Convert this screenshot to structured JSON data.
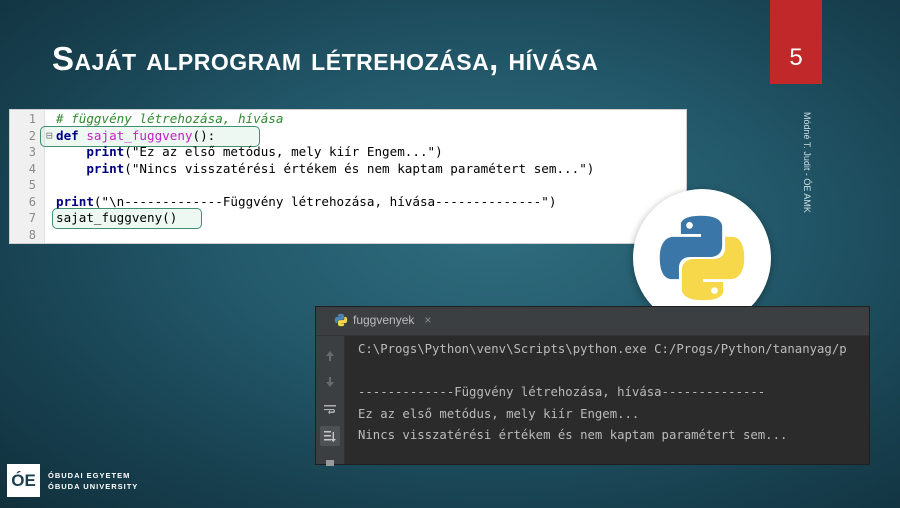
{
  "slide": {
    "title": "Saját alprogram létrehozása, hívása",
    "number": "5",
    "author_vertical": "Módné T. Judit - ÓE AMK",
    "accent_color": "#c0282a"
  },
  "editor": {
    "lines": [
      {
        "num": "1",
        "fold": "",
        "parts": [
          {
            "cls": "c-comment",
            "text": "# függvény létrehozása, hívása"
          }
        ]
      },
      {
        "num": "2",
        "fold": "⊟",
        "parts": [
          {
            "cls": "c-kw",
            "text": "def "
          },
          {
            "cls": "c-fn",
            "text": "sajat_fuggveny"
          },
          {
            "cls": "c-plain",
            "text": "():"
          }
        ]
      },
      {
        "num": "3",
        "fold": "",
        "parts": [
          {
            "cls": "c-plain",
            "text": "    "
          },
          {
            "cls": "c-kw",
            "text": "print"
          },
          {
            "cls": "c-plain",
            "text": "(\"Ez az első metódus, mely kiír Engem...\")"
          }
        ]
      },
      {
        "num": "4",
        "fold": "",
        "parts": [
          {
            "cls": "c-plain",
            "text": "    "
          },
          {
            "cls": "c-kw",
            "text": "print"
          },
          {
            "cls": "c-plain",
            "text": "(\"Nincs visszatérési értékem és nem kaptam paramétert sem...\")"
          }
        ]
      },
      {
        "num": "5",
        "fold": "",
        "parts": []
      },
      {
        "num": "6",
        "fold": "",
        "parts": [
          {
            "cls": "c-kw",
            "text": "print"
          },
          {
            "cls": "c-plain",
            "text": "(\"\\n-------------Függvény létrehozása, hívása--------------\")"
          }
        ]
      },
      {
        "num": "7",
        "fold": "",
        "parts": [
          {
            "cls": "c-plain",
            "text": "sajat_fuggveny()"
          }
        ]
      },
      {
        "num": "8",
        "fold": "",
        "parts": []
      }
    ]
  },
  "console": {
    "tab_label": "fuggvenyek",
    "tab_close": "×",
    "side_icons": [
      "arrow-up-icon",
      "arrow-down-icon",
      "soft-wrap-icon",
      "scroll-to-end-icon",
      "print-icon"
    ],
    "output": [
      "C:\\Progs\\Python\\venv\\Scripts\\python.exe C:/Progs/Python/tananyag/p",
      "",
      "-------------Függvény létrehozása, hívása--------------",
      "Ez az első metódus, mely kiír Engem...",
      "Nincs visszatérési értékem és nem kaptam paramétert sem..."
    ]
  },
  "footer": {
    "logo_mark": "ÓE",
    "line1": "ÓBUDAI EGYETEM",
    "line2": "ÓBUDA UNIVERSITY"
  }
}
